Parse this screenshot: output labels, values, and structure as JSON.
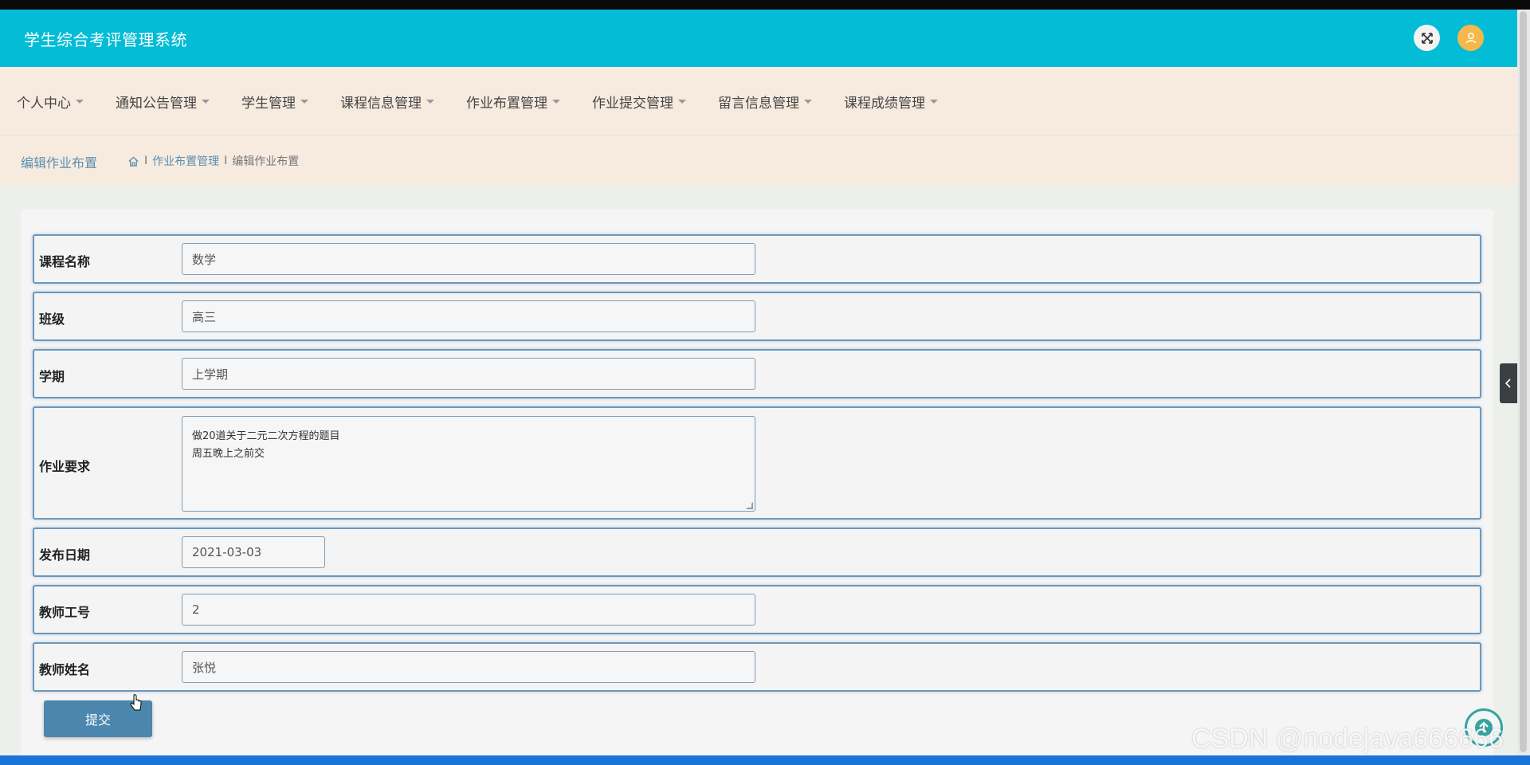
{
  "header": {
    "title": "学生综合考评管理系统",
    "icons": [
      "fullscreen-icon",
      "user-icon"
    ]
  },
  "nav": {
    "items": [
      {
        "label": "个人中心"
      },
      {
        "label": "通知公告管理"
      },
      {
        "label": "学生管理"
      },
      {
        "label": "课程信息管理"
      },
      {
        "label": "作业布置管理"
      },
      {
        "label": "作业提交管理"
      },
      {
        "label": "留言信息管理"
      },
      {
        "label": "课程成绩管理"
      }
    ]
  },
  "page": {
    "title": "编辑作业布置",
    "breadcrumb": {
      "home_icon": "home-icon",
      "sep": "I",
      "parent": "作业布置管理",
      "current": "编辑作业布置"
    }
  },
  "form": {
    "course_name": {
      "label": "课程名称",
      "value": "数学"
    },
    "class": {
      "label": "班级",
      "value": "高三"
    },
    "semester": {
      "label": "学期",
      "value": "上学期"
    },
    "requirement": {
      "label": "作业要求",
      "line1": "做20道关于二元二次方程的题目",
      "line2": "周五晚上之前交"
    },
    "publish_date": {
      "label": "发布日期",
      "value": "2021-03-03"
    },
    "teacher_id": {
      "label": "教师工号",
      "value": "2"
    },
    "teacher_name": {
      "label": "教师姓名",
      "value": "张悦"
    },
    "submit_label": "提交"
  },
  "watermark": "CSDN @nodejava666666",
  "colors": {
    "header_bg": "#03bcd6",
    "nav_bg": "#f7ebe0",
    "accent": "#4a86ad",
    "field_border": "#6b97bd"
  }
}
